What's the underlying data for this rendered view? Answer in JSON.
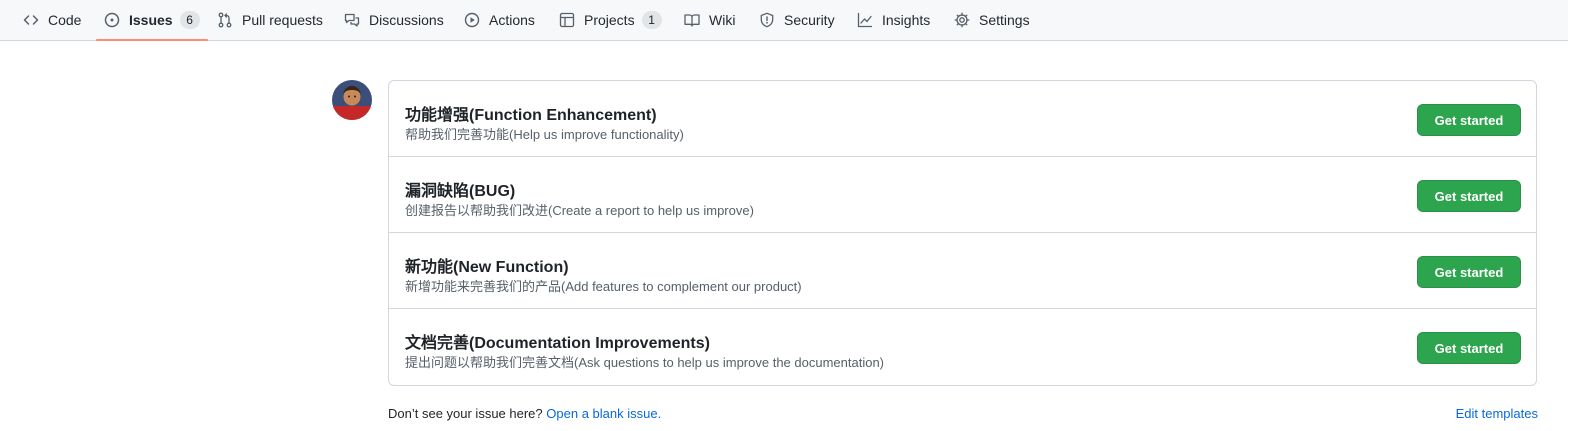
{
  "nav": {
    "tabs": [
      {
        "label": "Code",
        "icon": "code-icon"
      },
      {
        "label": "Issues",
        "icon": "issue-opened-icon",
        "count": "6",
        "selected": true
      },
      {
        "label": "Pull requests",
        "icon": "git-pull-request-icon"
      },
      {
        "label": "Discussions",
        "icon": "comment-discussion-icon"
      },
      {
        "label": "Actions",
        "icon": "play-icon"
      },
      {
        "label": "Projects",
        "icon": "table-icon",
        "count": "1"
      },
      {
        "label": "Wiki",
        "icon": "book-icon"
      },
      {
        "label": "Security",
        "icon": "shield-icon"
      },
      {
        "label": "Insights",
        "icon": "graph-icon"
      },
      {
        "label": "Settings",
        "icon": "gear-icon"
      }
    ],
    "selected_underline_color": "#fd8c73"
  },
  "templates": [
    {
      "title": "功能增强(Function Enhancement)",
      "description": "帮助我们完善功能(Help us improve functionality)",
      "button": "Get started"
    },
    {
      "title": "漏洞缺陷(BUG)",
      "description": "创建报告以帮助我们改进(Create a report to help us improve)",
      "button": "Get started"
    },
    {
      "title": "新功能(New Function)",
      "description": "新增功能来完善我们的产品(Add features to complement our product)",
      "button": "Get started"
    },
    {
      "title": "文档完善(Documentation Improvements)",
      "description": "提出问题以帮助我们完善文档(Ask questions to help us improve the documentation)",
      "button": "Get started"
    }
  ],
  "footer": {
    "prompt": "Don’t see your issue here?",
    "blank_issue_link": "Open a blank issue.",
    "edit_templates_link": "Edit templates"
  },
  "colors": {
    "primary_button": "#2da44e",
    "link": "#0969da"
  }
}
